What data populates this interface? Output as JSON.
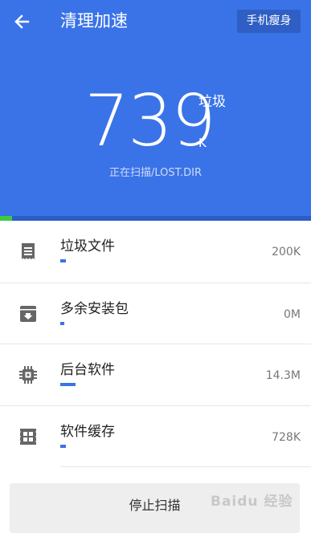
{
  "header": {
    "title": "清理加速",
    "slim_button": "手机瘦身",
    "amount": "739",
    "unit_top": "垃圾",
    "unit_bottom": "K",
    "scan_status": "正在扫描/LOST.DIR",
    "scan_progress_fraction": 0.04,
    "colors": {
      "background": "#3a73e8",
      "progress": "#3fca3f"
    }
  },
  "items": [
    {
      "title": "垃圾文件",
      "value": "200K",
      "icon": "document-list-icon",
      "bar_fraction": 0.03
    },
    {
      "title": "多余安装包",
      "value": "0M",
      "icon": "package-archive-icon",
      "bar_fraction": 0.02
    },
    {
      "title": "后台软件",
      "value": "14.3M",
      "icon": "cpu-chip-icon",
      "bar_fraction": 0.08
    },
    {
      "title": "软件缓存",
      "value": "728K",
      "icon": "cache-grid-icon",
      "bar_fraction": 0.03
    }
  ],
  "stop_button": "停止扫描",
  "watermark": "Baidu 经验"
}
